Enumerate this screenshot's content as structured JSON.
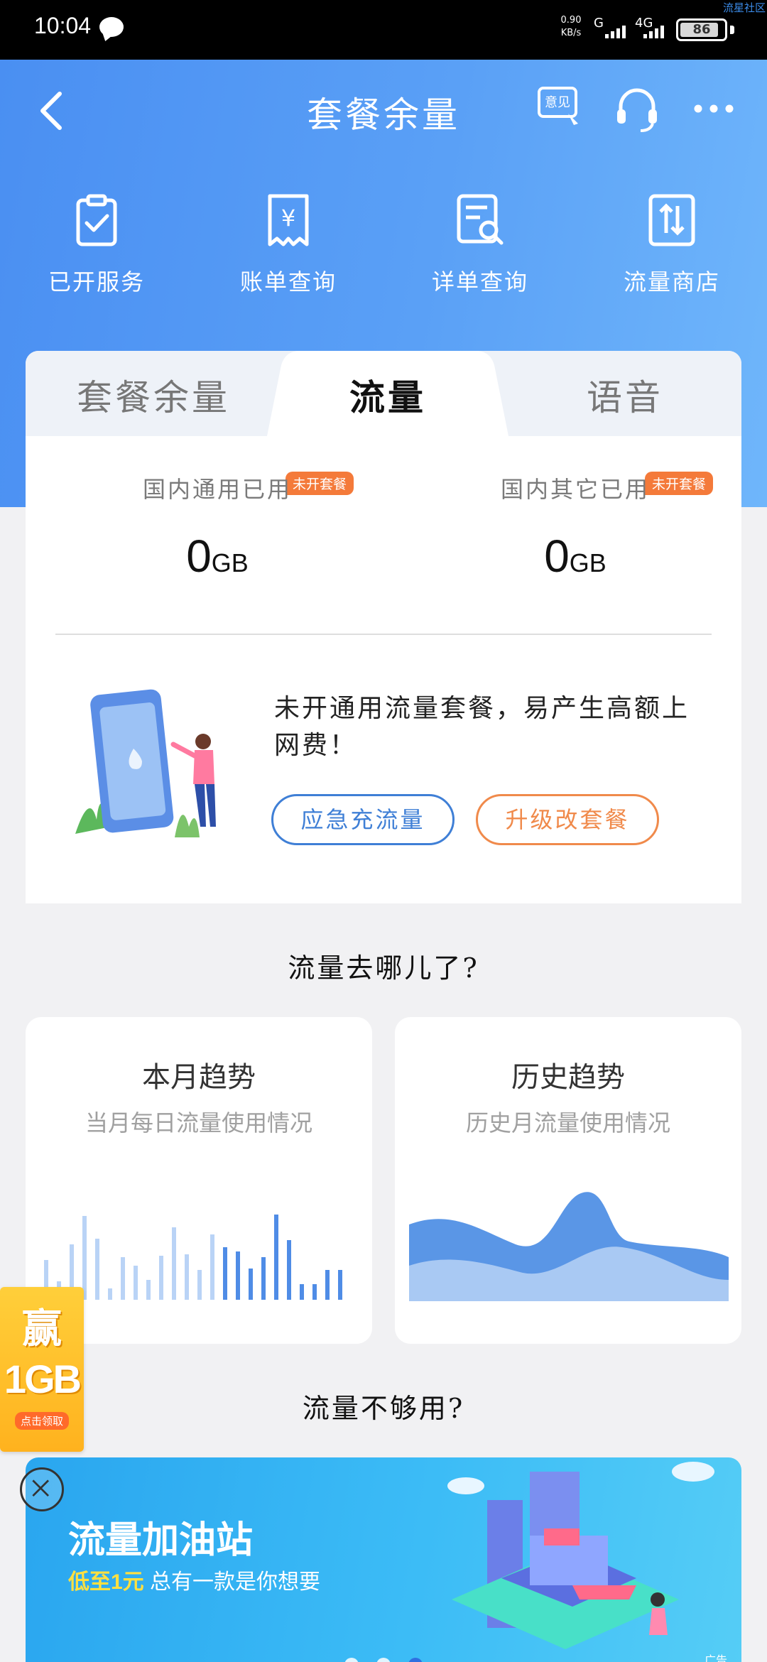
{
  "status": {
    "time": "10:04",
    "speed_value": "0.90",
    "speed_unit": "KB/s",
    "net1": "G",
    "net2": "4G",
    "battery": "86",
    "watermark": "流星社区"
  },
  "header": {
    "title": "套餐余量",
    "feedback_icon_label": "意见"
  },
  "quick_links": [
    {
      "label": "已开服务",
      "icon": "clipboard-check-icon"
    },
    {
      "label": "账单查询",
      "icon": "bill-yen-icon"
    },
    {
      "label": "详单查询",
      "icon": "detail-search-icon"
    },
    {
      "label": "流量商店",
      "icon": "data-store-icon"
    }
  ],
  "tabs": [
    {
      "label": "套餐余量",
      "active": false
    },
    {
      "label": "流量",
      "active": true
    },
    {
      "label": "语音",
      "active": false
    }
  ],
  "usage": [
    {
      "label": "国内通用已用",
      "value": "0",
      "unit": "GB",
      "badge": "未开套餐"
    },
    {
      "label": "国内其它已用",
      "value": "0",
      "unit": "GB",
      "badge": "未开套餐"
    }
  ],
  "promo": {
    "text": "未开通用流量套餐，易产生高额上网费！",
    "btn_emergency": "应急充流量",
    "btn_upgrade": "升级改套餐"
  },
  "where_title": "流量去哪儿了?",
  "trends": {
    "monthly": {
      "title": "本月趋势",
      "subtitle": "当月每日流量使用情况"
    },
    "history": {
      "title": "历史趋势",
      "subtitle": "历史月流量使用情况"
    }
  },
  "not_enough_title": "流量不够用?",
  "float_badge": {
    "line1": "赢",
    "line2": "1GB",
    "line3": "点击领取"
  },
  "banner": {
    "title": "流量加油站",
    "sub_highlight": "低至1元",
    "sub_rest": " 总有一款是你想要",
    "ad_label": "广告"
  },
  "colors": {
    "brand_blue": "#4a8ff2",
    "orange": "#f47a3a",
    "bar_light": "#b9d3f6",
    "bar_dark": "#4f8ce6"
  }
}
